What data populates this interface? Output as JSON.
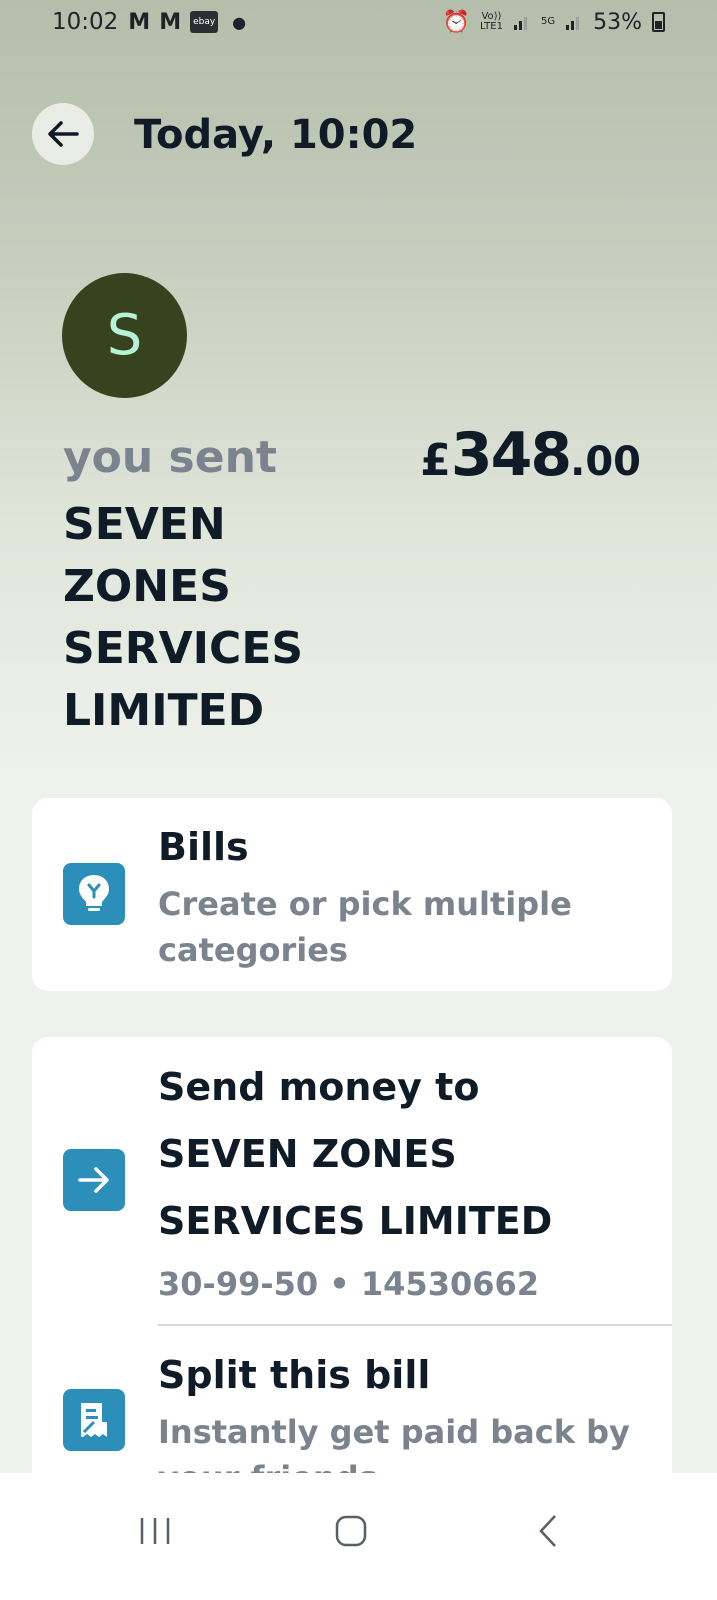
{
  "status_bar": {
    "time": "10:02",
    "notifications": [
      "M",
      "M"
    ],
    "ebay_label": "ebay",
    "network_volte": "Vo))",
    "network_lte": "LTE1",
    "network_5g": "5G",
    "battery": "53%"
  },
  "header": {
    "title": "Today, 10:02"
  },
  "transaction": {
    "avatar_letter": "S",
    "direction_label": "you sent",
    "merchant_name": "SEVEN ZONES SERVICES LIMITED",
    "amount_currency": "£",
    "amount_major": "348",
    "amount_minor": ".00"
  },
  "category": {
    "title": "Bills",
    "subtitle_line1": "Create or pick multiple",
    "subtitle_line2": "categories",
    "icon": "lightbulb-icon"
  },
  "send_money": {
    "line1": "Send money to",
    "line2": "SEVEN ZONES",
    "line3": "SERVICES LIMITED",
    "account": "30-99-50 • 14530662",
    "icon": "arrow-right-icon"
  },
  "split_bill": {
    "title": "Split this bill",
    "subtitle": "Instantly get paid back by",
    "subtitle_line2": "your friends",
    "icon": "receipt-icon"
  },
  "colors": {
    "accent_tile": "#2b8fba",
    "avatar_bg": "#37421f",
    "avatar_text": "#b7f2d6"
  }
}
